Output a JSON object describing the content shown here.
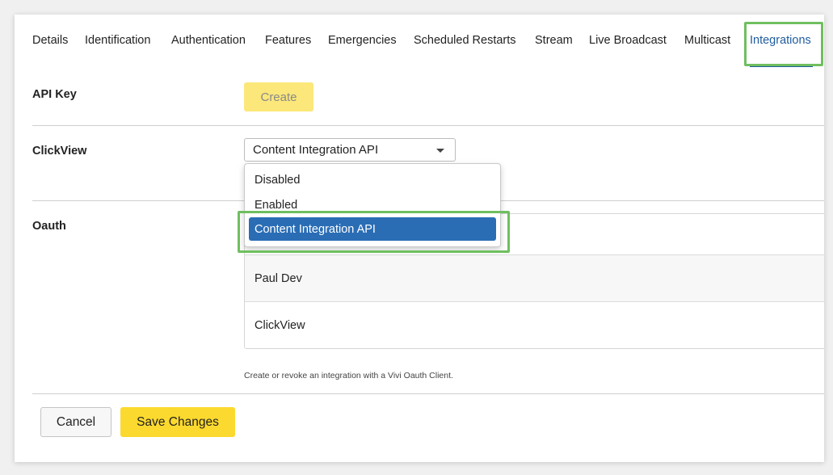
{
  "tabs": [
    {
      "label": "Details"
    },
    {
      "label": "Identification"
    },
    {
      "label": "Authentication"
    },
    {
      "label": "Features"
    },
    {
      "label": "Emergencies"
    },
    {
      "label": "Scheduled Restarts"
    },
    {
      "label": "Stream"
    },
    {
      "label": "Live Broadcast"
    },
    {
      "label": "Multicast"
    },
    {
      "label": "Integrations",
      "active": true
    }
  ],
  "api_key": {
    "label": "API Key",
    "create_button": "Create"
  },
  "clickview": {
    "label": "ClickView",
    "selected_value": "Content Integration API",
    "options": [
      "Disabled",
      "Enabled",
      "Content Integration API"
    ]
  },
  "oauth": {
    "label": "Oauth",
    "clients": [
      "Paul Dev",
      "ClickView"
    ],
    "help_text": "Create or revoke an integration with a Vivi Oauth Client."
  },
  "footer": {
    "cancel_label": "Cancel",
    "save_label": "Save Changes"
  },
  "colors": {
    "accent": "#1f5c9e",
    "primary_button": "#fcd92e",
    "create_button_disabled": "#fbe77a",
    "selected_option": "#2a6db5",
    "highlight_annotation": "#6fbf5f"
  }
}
